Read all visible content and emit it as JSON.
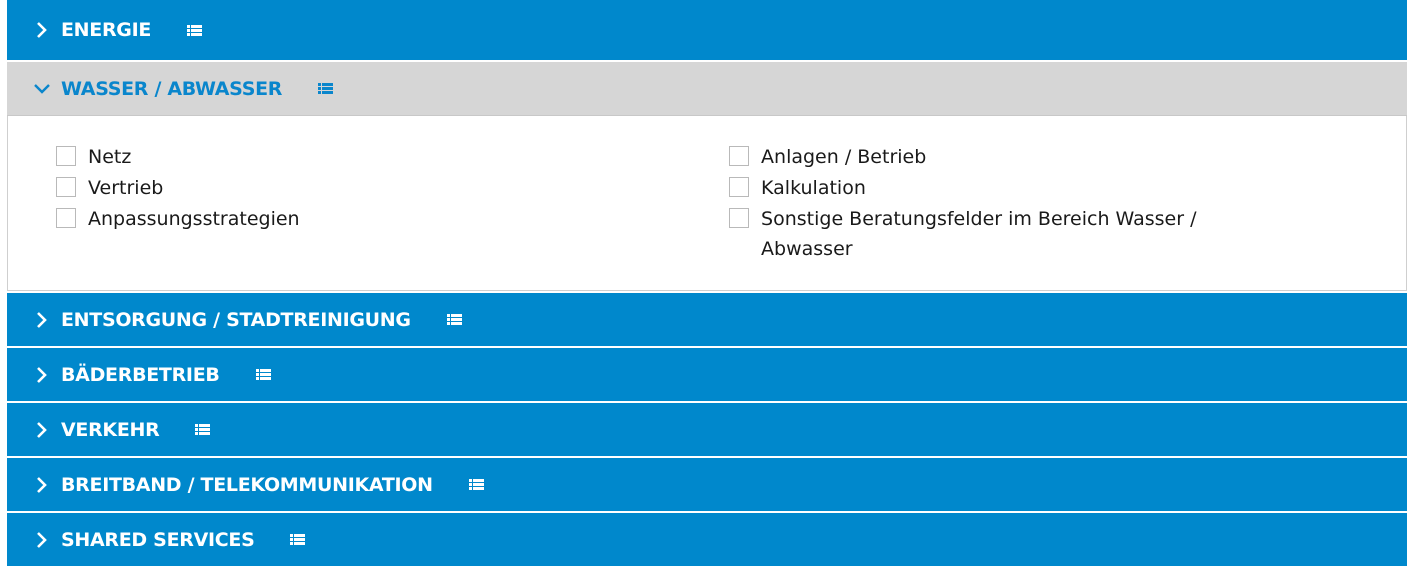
{
  "colors": {
    "header_bg": "#0088cc",
    "open_header_bg": "#d6d6d6",
    "open_header_text": "#0a86cc",
    "header_text": "#ffffff"
  },
  "sections": [
    {
      "title": "ENERGIE",
      "expanded": false,
      "chevron": "chevron-right-icon",
      "list_icon": "list-icon"
    },
    {
      "title": "WASSER / ABWASSER",
      "expanded": true,
      "chevron": "chevron-down-icon",
      "list_icon": "list-icon",
      "options_left": [
        "Netz",
        "Vertrieb",
        "Anpassungsstrategien"
      ],
      "options_right": [
        "Anlagen / Betrieb",
        "Kalkulation",
        "Sonstige Beratungsfelder im Bereich Wasser / Abwasser"
      ]
    },
    {
      "title": "ENTSORGUNG / STADTREINIGUNG",
      "expanded": false,
      "chevron": "chevron-right-icon",
      "list_icon": "list-icon"
    },
    {
      "title": "BÄDERBETRIEB",
      "expanded": false,
      "chevron": "chevron-right-icon",
      "list_icon": "list-icon"
    },
    {
      "title": "VERKEHR",
      "expanded": false,
      "chevron": "chevron-right-icon",
      "list_icon": "list-icon"
    },
    {
      "title": "BREITBAND / TELEKOMMUNIKATION",
      "expanded": false,
      "chevron": "chevron-right-icon",
      "list_icon": "list-icon"
    },
    {
      "title": "SHARED SERVICES",
      "expanded": false,
      "chevron": "chevron-right-icon",
      "list_icon": "list-icon"
    }
  ]
}
